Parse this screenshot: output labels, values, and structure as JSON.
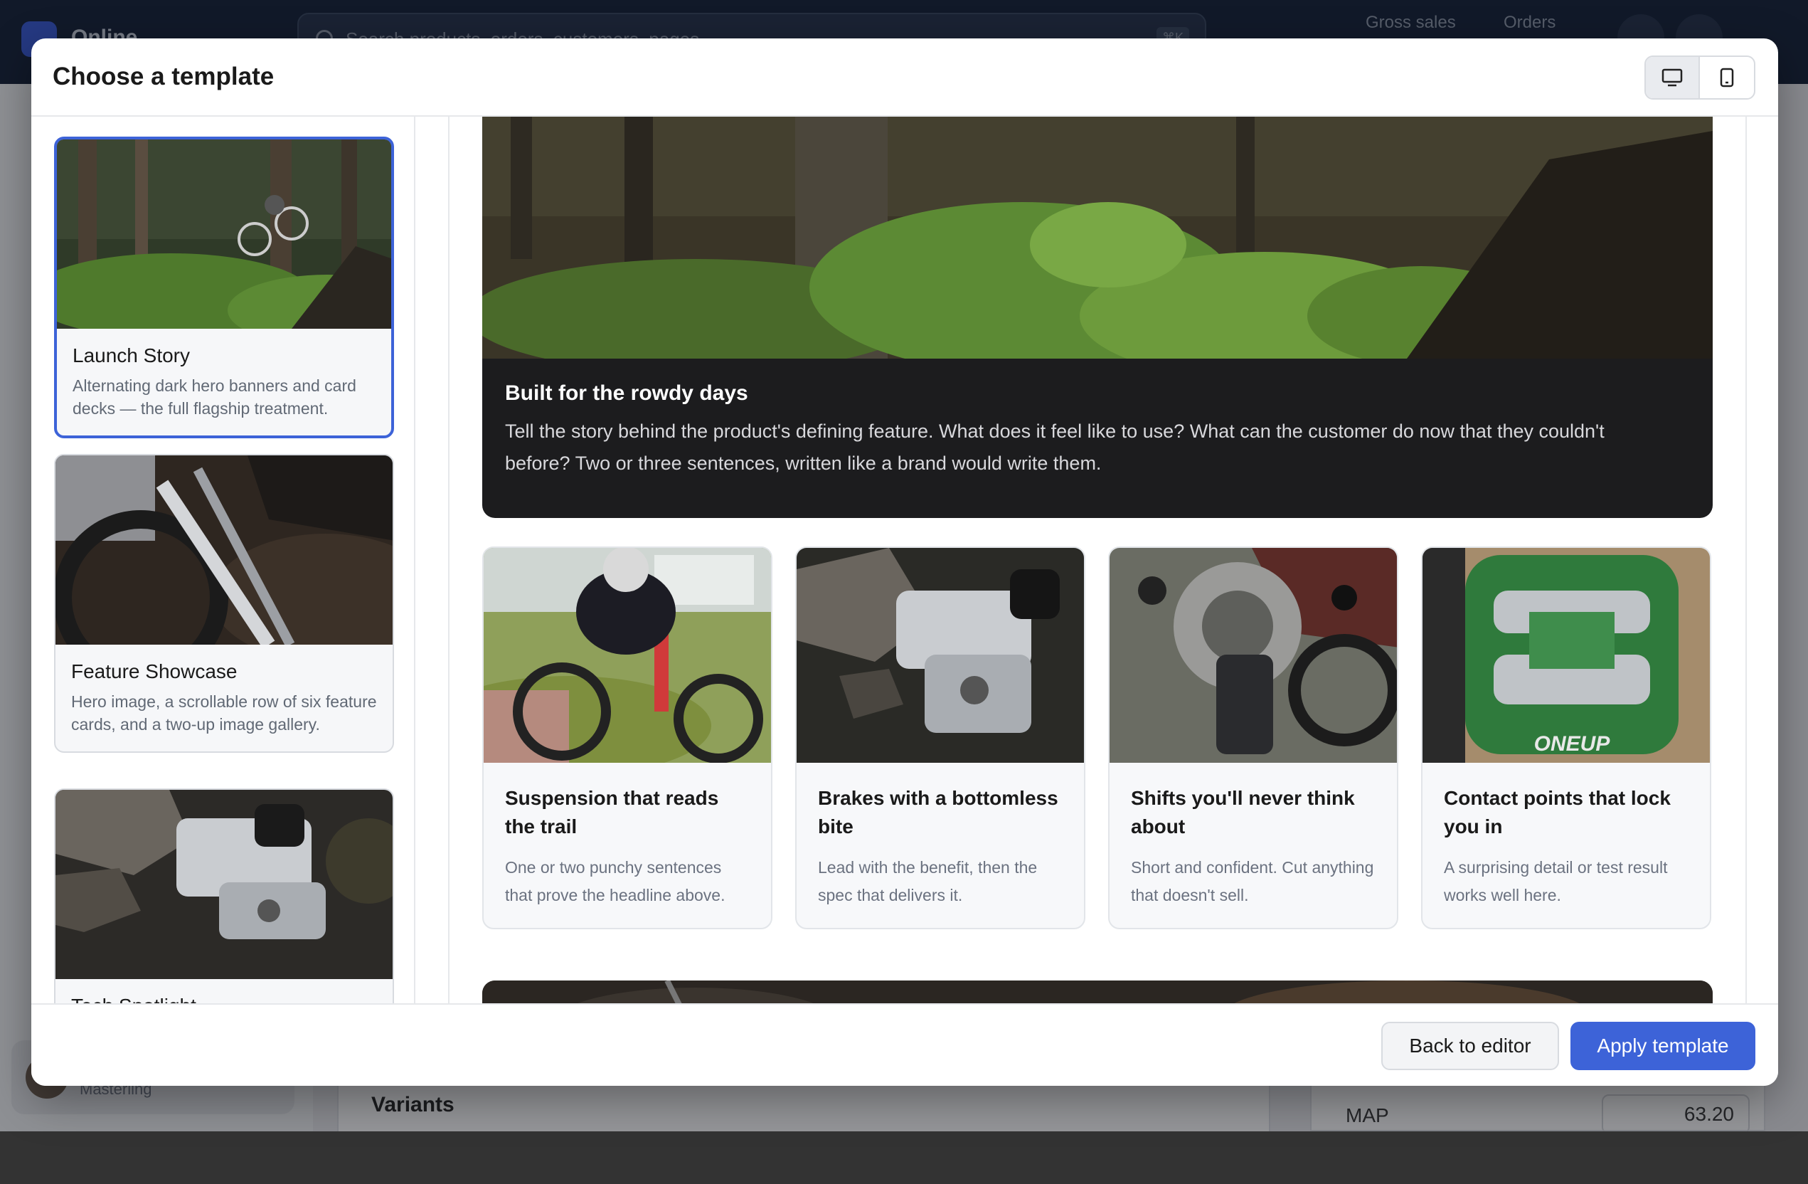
{
  "background": {
    "store_name": "Online",
    "search_placeholder": "Search products, orders, customers, pages",
    "search_shortcut": "⌘K",
    "nav": [
      "Gross sales",
      "Orders"
    ],
    "user_name": "Masterling",
    "variants_heading": "Variants",
    "map_label": "MAP",
    "map_value": "63.20"
  },
  "modal": {
    "title": "Choose a template",
    "view_toggle": {
      "selected": "desktop",
      "options": [
        "desktop-icon",
        "mobile-icon"
      ]
    }
  },
  "templates": [
    {
      "name": "Launch Story",
      "description": "Alternating dark hero banners and card decks — the full flagship treatment.",
      "selected": true
    },
    {
      "name": "Feature Showcase",
      "description": "Hero image, a scrollable row of six feature cards, and a two-up image gallery.",
      "selected": false
    },
    {
      "name": "Tech Spotlight",
      "description": "",
      "selected": false
    }
  ],
  "preview": {
    "hero": {
      "title": "Built for the rowdy days",
      "text": "Tell the story behind the product's defining feature. What does it feel like to use? What can the customer do now that they couldn't before? Two or three sentences, written like a brand would write them."
    },
    "cards": [
      {
        "title": "Suspension that reads the trail",
        "text": "One or two punchy sentences that prove the headline above."
      },
      {
        "title": "Brakes with a bottomless bite",
        "text": "Lead with the benefit, then the spec that delivers it."
      },
      {
        "title": "Shifts you'll never think about",
        "text": "Short and confident. Cut anything that doesn't sell."
      },
      {
        "title": "Contact points that lock you in",
        "text": "A surprising detail or test result works well here."
      }
    ],
    "pedal_brand": "ONEUP"
  },
  "footer": {
    "back_label": "Back to editor",
    "apply_label": "Apply template"
  },
  "colors": {
    "accent": "#3d63d8",
    "hero_bg": "#1c1c1e",
    "topbar": "#0f1d33"
  }
}
